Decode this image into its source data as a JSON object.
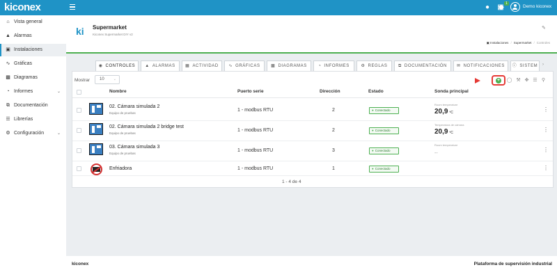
{
  "topbar": {
    "logo": "kiconex",
    "notifications_badge": "1",
    "messages_badge": "1",
    "user_name": "Demo kiconex",
    "colors": {
      "bar": "#1f93c6",
      "badge_red": "#e53935",
      "badge_green": "#4caf50"
    }
  },
  "sidebar": {
    "items": [
      {
        "label": "Vista general",
        "icon": "home-icon"
      },
      {
        "label": "Alarmas",
        "icon": "bell-icon"
      },
      {
        "label": "Instalaciones",
        "icon": "factory-icon",
        "active": true
      },
      {
        "label": "Gráficas",
        "icon": "chart-icon"
      },
      {
        "label": "Diagramas",
        "icon": "image-icon"
      },
      {
        "label": "Informes",
        "icon": "pie-icon",
        "expandable": true
      },
      {
        "label": "Documentación",
        "icon": "document-icon"
      },
      {
        "label": "Librerías",
        "icon": "list-icon"
      },
      {
        "label": "Configuración",
        "icon": "gear-icon",
        "expandable": true
      }
    ]
  },
  "header": {
    "logo_mark": "ki",
    "title": "Supermarket",
    "subtitle": "Kiconex Supermarket DIY v2",
    "breadcrumb": [
      "Instalaciones",
      "Supermarket",
      "Controles"
    ]
  },
  "tabs": [
    {
      "label": "CONTROLES",
      "icon": "gauge-icon",
      "active": true
    },
    {
      "label": "ALARMAS",
      "icon": "bell-icon"
    },
    {
      "label": "ACTIVIDAD",
      "icon": "calendar-icon"
    },
    {
      "label": "GRÁFICAS",
      "icon": "chart-icon"
    },
    {
      "label": "DIAGRAMAS",
      "icon": "image-icon"
    },
    {
      "label": "INFORMES",
      "icon": "pie-icon"
    },
    {
      "label": "REGLAS",
      "icon": "cogs-icon"
    },
    {
      "label": "DOCUMENTACIÓN",
      "icon": "copy-icon"
    },
    {
      "label": "NOTIFICACIONES",
      "icon": "envelope-icon"
    },
    {
      "label": "SISTEM",
      "icon": "info-icon"
    }
  ],
  "toolbar": {
    "show_label": "Mostrar",
    "page_size": "10",
    "add_symbol": "+"
  },
  "table": {
    "columns": {
      "name": "Nombre",
      "port": "Puerto serie",
      "address": "Dirección",
      "state": "Estado",
      "probe": "Sonda principal"
    },
    "rows": [
      {
        "name": "02. Cámara simulada 2",
        "type": "Equipo de pruebas",
        "port": "1 - modbus RTU",
        "address": "2",
        "state": "Conectado",
        "probe_label": "Room temperature",
        "probe_value": "20,9",
        "probe_unit": "ºC"
      },
      {
        "name": "02. Cámara simulada 2 bridge test",
        "type": "Equipo de pruebas",
        "port": "1 - modbus RTU",
        "address": "2",
        "state": "Conectado",
        "probe_label": "Temperatura de cámara",
        "probe_value": "20,9",
        "probe_unit": "ºC"
      },
      {
        "name": "03. Cámara simulada 3",
        "type": "Equipo de pruebas",
        "port": "1 - modbus RTU",
        "address": "3",
        "state": "Conectado",
        "probe_label": "Room temperature",
        "probe_value": "--",
        "probe_unit": ""
      },
      {
        "name": "Enfriadora",
        "type": "",
        "port": "1 - modbus RTU",
        "address": "1",
        "state": "Conectado",
        "probe_label": "",
        "probe_value": "",
        "probe_unit": ""
      }
    ],
    "pagination": "1 - 4 de 4"
  },
  "footer": {
    "left": "kiconex",
    "right": "Plataforma de supervisión industrial"
  }
}
